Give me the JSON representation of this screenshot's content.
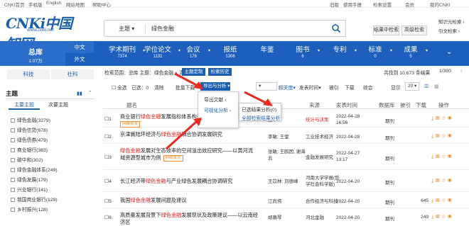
{
  "topbar": {
    "links": [
      "CNKI首页",
      "手机版",
      "English",
      "网站地图",
      "帮助中心"
    ],
    "right": [
      "旧版",
      "使用手册",
      "检索设置",
      "会员",
      "我的CNKI"
    ]
  },
  "logo": {
    "text": "CNKi中国知网",
    "url": "www.cnki.net"
  },
  "search": {
    "field": "主题",
    "query": "绿色金融",
    "btn_in_results": "结果中检索",
    "btn_advanced": "高级检索",
    "link_knowledge": "知识元检索",
    "link_ref": "引文检索"
  },
  "nav": {
    "zongku": {
      "label": "总库",
      "count": "1.07万"
    },
    "lang_cn": "中文",
    "lang_en": "外文",
    "items": [
      {
        "label": "学术期刊",
        "count": "7374"
      },
      {
        "label": "学位论文",
        "count": "1131"
      },
      {
        "label": "会议",
        "count": "176"
      },
      {
        "label": "报纸",
        "count": "1306"
      },
      {
        "label": "年鉴",
        "count": ""
      },
      {
        "label": "图书",
        "count": "6"
      },
      {
        "label": "专利",
        "count": ""
      },
      {
        "label": "标准",
        "count": "0"
      },
      {
        "label": "成果",
        "count": "5"
      }
    ]
  },
  "left": {
    "tab_science": "科技",
    "tab_social": "社科",
    "heading": "主题",
    "subtab_main": "主要主题",
    "subtab_sec": "次要主题",
    "facets": [
      "绿色金融(3279)",
      "绿色信贷(678)",
      "绿色债券(479)",
      "商业银行(383)",
      "碳中和(302)",
      "绿色金融体系(249)",
      "绿色发展(179)",
      "兴业银行(141)",
      "我国商业银行(129)",
      "乡村振兴(128)"
    ]
  },
  "crumb": {
    "text": "检索范围：总库   主题：绿色金融   ×   清除",
    "tag1": "主题定制",
    "tag2": "检索历史"
  },
  "resinfo": {
    "total": "共找到 10,673 条结果",
    "page": "1/300"
  },
  "toolbar": {
    "select_all": "全选",
    "selected": "已选：0",
    "clear": "清除",
    "batch_download": "批量下载",
    "export": "导出与分析",
    "sort_label": "排序：",
    "sort_rel": "相关度",
    "sort_date": "发表时间",
    "sort_cite": "被引",
    "sort_dl": "下载",
    "sort_comp": "综合",
    "display": "显示",
    "page_size": "20"
  },
  "menu": {
    "export": "导出文献",
    "visual": "可视化分析",
    "selected_analysis": "已选结果分析(0)",
    "all_analysis": "全部检索结果分析"
  },
  "table": {
    "headers": {
      "title": "题名",
      "author": "作者",
      "source": "来源",
      "date": "发表时间",
      "db": "数据库",
      "cited": "被引",
      "dl": "下载",
      "ops": "操作"
    },
    "rows": [
      {
        "idx": "1",
        "t1": "商业银行",
        "hl": "绿色金融",
        "t2": "发展指标体系构建及测度",
        "badge": "网络首发",
        "author": "王平",
        "source": "统计与决策",
        "date": "2022-04-28 16:56",
        "db": "期刊",
        "dl": ""
      },
      {
        "idx": "2",
        "t1": "京津冀陆环经济与",
        "hl": "绿色金融",
        "t2": "耦合协调发展研究",
        "badge": "",
        "author": "李敏; 王蓥",
        "source": "工业技术经济",
        "date": "2022-04-28",
        "db": "期刊",
        "dl": ""
      },
      {
        "idx": "3",
        "t1": "",
        "hl": "绿色金融",
        "t2": "发展对生态效率的空间溢出效应研究——以黄河流域资源型城市为例",
        "badge": "网络首发",
        "author": "张敏; 王鸥因; 谢海云",
        "source": "金融发展研究",
        "date": "2022-04-27 13:17",
        "db": "期刊",
        "dl": ""
      },
      {
        "idx": "4",
        "t1": "长江经济带",
        "hl": "绿色金融",
        "t2": "与产业绿色发展耦合协调研究",
        "badge": "",
        "author": "王苡林; 刘德峰",
        "source": "河南大学学报(哲学社会科学版)",
        "date": "2022-04-20",
        "db": "期刊",
        "dl": ""
      },
      {
        "idx": "5",
        "t1": "我国",
        "hl": "绿色金融",
        "t2": "发展问题及建议",
        "badge": "",
        "author": "江尚伟",
        "source": "合作经济与科技",
        "date": "2022-04-20",
        "db": "期刊",
        "dl": "645"
      },
      {
        "idx": "6",
        "t1": "高质量发展背景下",
        "hl": "绿色金融",
        "t2": "发展现状及政策建议——以云南经济区",
        "badge": "",
        "author": "胡慕琴",
        "source": "河北金融",
        "date": "2022-04-20",
        "db": "期刊",
        "dl": "249"
      }
    ]
  }
}
